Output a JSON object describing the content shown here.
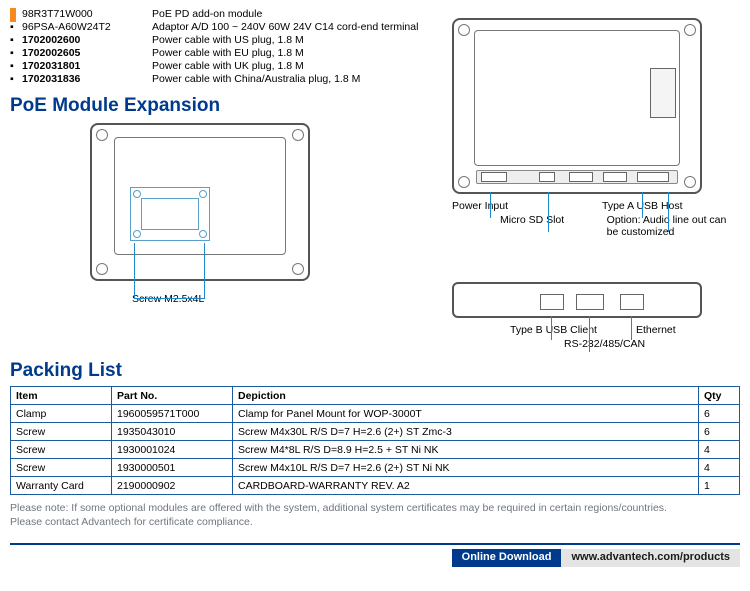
{
  "accessories": [
    {
      "pn": "98R3T71W000",
      "bold": false,
      "desc": "PoE PD add-on module"
    },
    {
      "pn": "96PSA-A60W24T2",
      "bold": false,
      "desc": "Adaptor A/D 100 ~ 240V 60W 24V C14 cord-end terminal"
    },
    {
      "pn": "1702002600",
      "bold": true,
      "desc": "Power cable with US plug, 1.8 M"
    },
    {
      "pn": "1702002605",
      "bold": true,
      "desc": "Power cable with EU plug, 1.8 M"
    },
    {
      "pn": "1702031801",
      "bold": true,
      "desc": "Power cable with UK plug, 1.8 M"
    },
    {
      "pn": "1702031836",
      "bold": true,
      "desc": "Power cable with China/Australia plug, 1.8 M"
    }
  ],
  "sections": {
    "poe_expansion": "PoE Module Expansion",
    "packing_list": "Packing List"
  },
  "fig1": {
    "screw_label": "Screw M2.5x4L"
  },
  "right": {
    "power_input": "Power Input",
    "type_a_usb": "Type A USB Host",
    "micro_sd": "Micro SD Slot",
    "audio_opt": "Option: Audio line out can be customized",
    "type_b_usb": "Type B USB Client",
    "ethernet": "Ethernet",
    "rs": "RS-232/485/CAN"
  },
  "packing": {
    "headers": {
      "item": "Item",
      "pn": "Part No.",
      "dep": "Depiction",
      "qty": "Qty"
    },
    "rows": [
      {
        "item": "Clamp",
        "pn": "1960059571T000",
        "dep": "Clamp for Panel Mount for WOP-3000T",
        "qty": "6"
      },
      {
        "item": "Screw",
        "pn": "1935043010",
        "dep": "Screw M4x30L R/S D=7 H=2.6 (2+) ST Zmc-3",
        "qty": "6"
      },
      {
        "item": "Screw",
        "pn": "1930001024",
        "dep": "Screw M4*8L R/S D=8.9 H=2.5 + ST Ni NK",
        "qty": "4"
      },
      {
        "item": "Screw",
        "pn": "1930000501",
        "dep": "Screw M4x10L R/S D=7 H=2.6 (2+) ST Ni NK",
        "qty": "4"
      },
      {
        "item": "Warranty Card",
        "pn": "2190000902",
        "dep": "CARDBOARD-WARRANTY REV. A2",
        "qty": "1"
      }
    ]
  },
  "notes": {
    "l1": "Please note: If some optional modules are offered with the system, additional system certificates may be required in certain regions/countries.",
    "l2": "Please contact Advantech for certificate compliance."
  },
  "download": {
    "label": "Online Download",
    "url": "www.advantech.com/products"
  }
}
